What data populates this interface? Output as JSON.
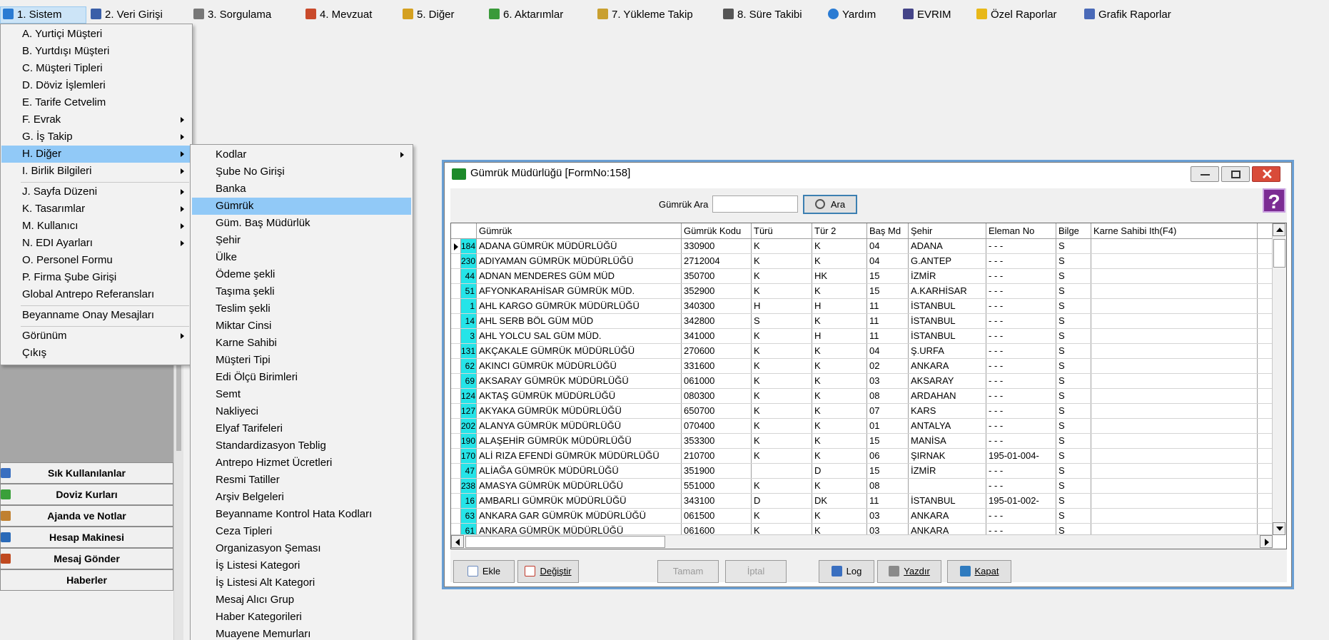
{
  "menubar": {
    "items": [
      {
        "label": "1.  Sistem",
        "icon": "system-icon",
        "color": "#2a7bd3"
      },
      {
        "label": "2.  Veri Girişi",
        "icon": "edit-icon",
        "color": "#3a5fa8"
      },
      {
        "label": "3.  Sorgulama",
        "icon": "query-icon",
        "color": "#777777"
      },
      {
        "label": "4.  Mevzuat",
        "icon": "books-icon",
        "color": "#c94a2b"
      },
      {
        "label": "5.  Diğer",
        "icon": "shapes-icon",
        "color": "#d4a020"
      },
      {
        "label": "6.  Aktarımlar",
        "icon": "transfer-icon",
        "color": "#3a9a3a"
      },
      {
        "label": "7.  Yükleme Takip",
        "icon": "truck-icon",
        "color": "#c9a030"
      },
      {
        "label": "8. Süre Takibi",
        "icon": "clock-icon",
        "color": "#555555"
      },
      {
        "label": "Yardım",
        "icon": "help-icon",
        "color": "#2a7bd3"
      },
      {
        "label": "EVRIM",
        "icon": "evrim-icon",
        "color": "#444488"
      },
      {
        "label": "Özel Raporlar",
        "icon": "star-icon",
        "color": "#e8b818"
      },
      {
        "label": "Grafik Raporlar",
        "icon": "chart-icon",
        "color": "#4a6ab8"
      }
    ]
  },
  "sistem_menu": {
    "items": [
      {
        "label": "A.  Yurtiçi Müşteri",
        "submenu": false
      },
      {
        "label": "B.  Yurtdışı Müşteri",
        "submenu": false
      },
      {
        "label": "C.  Müşteri Tipleri",
        "submenu": false
      },
      {
        "label": "D.  Döviz İşlemleri",
        "submenu": false
      },
      {
        "label": "E.  Tarife Cetvelim",
        "submenu": false
      },
      {
        "label": "F.  Evrak",
        "submenu": true
      },
      {
        "label": "G.  İş Takip",
        "submenu": true
      },
      {
        "label": "H.  Diğer",
        "submenu": true
      },
      {
        "label": "I.  Birlik Bilgileri",
        "submenu": true
      },
      {
        "label": "J.  Sayfa Düzeni",
        "submenu": true
      },
      {
        "label": "K.  Tasarımlar",
        "submenu": true
      },
      {
        "label": "M.  Kullanıcı",
        "submenu": true
      },
      {
        "label": "N.  EDI Ayarları",
        "submenu": true
      },
      {
        "label": "O.  Personel Formu",
        "submenu": false
      },
      {
        "label": "P.  Firma Şube Girişi",
        "submenu": false
      },
      {
        "label": "Global Antrepo Referansları",
        "submenu": false
      },
      {
        "label": "Beyanname Onay Mesajları",
        "submenu": false
      },
      {
        "label": "Görünüm",
        "submenu": true
      },
      {
        "label": "Çıkış",
        "submenu": false
      }
    ]
  },
  "diger_menu": {
    "items": [
      "Kodlar",
      "Şube No Girişi",
      "Banka",
      "Gümrük",
      "Güm. Baş Müdürlük",
      "Şehir",
      "Ülke",
      "Ödeme şekli",
      "Taşıma şekli",
      "Teslim şekli",
      "Miktar Cinsi",
      "Karne Sahibi",
      "Müşteri  Tipi",
      "Edi Ölçü Birimleri",
      "Semt",
      "Nakliyeci",
      "Elyaf Tarifeleri",
      "Standardizasyon Teblig",
      "Antrepo Hizmet Ücretleri",
      "Resmi Tatiller",
      "Arşiv Belgeleri",
      "Beyanname Kontrol Hata Kodları",
      "Ceza Tipleri",
      "Organizasyon Şeması",
      "İş Listesi Kategori",
      "İş Listesi Alt Kategori",
      "Mesaj Alıcı Grup",
      "Haber Kategorileri",
      "Muayene Memurları"
    ]
  },
  "left_panel": {
    "buttons": [
      {
        "label": "Sık Kullanılanlar",
        "icon": "favorites-icon",
        "color": "#3a6fc0"
      },
      {
        "label": "Doviz Kurları",
        "icon": "currency-icon",
        "color": "#3aa03a"
      },
      {
        "label": "Ajanda ve Notlar",
        "icon": "agenda-icon",
        "color": "#c08030"
      },
      {
        "label": "Hesap Makinesi",
        "icon": "calculator-icon",
        "color": "#2a6ab8"
      },
      {
        "label": "Mesaj Gönder",
        "icon": "users-icon",
        "color": "#c04a20"
      },
      {
        "label": "Haberler",
        "icon": "",
        "color": ""
      }
    ]
  },
  "window": {
    "title": "Gümrük Müdürlüğü [FormNo:158]",
    "search_label": "Gümrük Ara",
    "search_value": "",
    "search_button": "Ara",
    "columns": [
      "Gümrük",
      "Gümrük Kodu",
      "Türü",
      "Tür 2",
      "Baş Md",
      "Şehir",
      "Eleman No",
      "Bilge",
      "Karne Sahibi Ith(F4)"
    ],
    "rows": [
      [
        "184",
        "ADANA GÜMRÜK MÜDÜRLÜĞÜ",
        "330900",
        "K",
        "K",
        "04",
        "ADANA",
        " - - -",
        "S",
        ""
      ],
      [
        "230",
        "ADIYAMAN GÜMRÜK MÜDÜRLÜĞÜ",
        "2712004",
        "K",
        "K",
        "04",
        "G.ANTEP",
        " - - -",
        "S",
        ""
      ],
      [
        "44",
        "ADNAN MENDERES GÜM MÜD",
        "350700",
        "K",
        "HK",
        "15",
        "İZMİR",
        " - - -",
        "S",
        ""
      ],
      [
        "51",
        "AFYONKARAHİSAR GÜMRÜK MÜD.",
        "352900",
        "K",
        "K",
        "15",
        "A.KARHİSAR",
        " - - -",
        "S",
        ""
      ],
      [
        "1",
        "AHL KARGO GÜMRÜK MÜDÜRLÜĞÜ",
        "340300",
        "H",
        "H",
        "11",
        "İSTANBUL",
        " - - -",
        "S",
        ""
      ],
      [
        "14",
        "AHL SERB BÖL GÜM MÜD",
        "342800",
        "S",
        "K",
        "11",
        "İSTANBUL",
        " - - -",
        "S",
        ""
      ],
      [
        "3",
        "AHL YOLCU SAL GÜM MÜD.",
        "341000",
        "K",
        "H",
        "11",
        "İSTANBUL",
        " - - -",
        "S",
        ""
      ],
      [
        "131",
        "AKÇAKALE GÜMRÜK MÜDÜRLÜĞÜ",
        "270600",
        "K",
        "K",
        "04",
        "Ş.URFA",
        " - - -",
        "S",
        ""
      ],
      [
        "62",
        "AKINCI GÜMRÜK MÜDÜRLÜĞÜ",
        "331600",
        "K",
        "K",
        "02",
        "ANKARA",
        " - - -",
        "S",
        ""
      ],
      [
        "69",
        "AKSARAY GÜMRÜK MÜDÜRLÜĞÜ",
        "061000",
        "K",
        "K",
        "03",
        "AKSARAY",
        " - - -",
        "S",
        ""
      ],
      [
        "124",
        "AKTAŞ GÜMRÜK MÜDÜRLÜĞÜ",
        "080300",
        "K",
        "K",
        "08",
        "ARDAHAN",
        " - - -",
        "S",
        ""
      ],
      [
        "127",
        "AKYAKA GÜMRÜK MÜDÜRLÜĞÜ",
        "650700",
        "K",
        "K",
        "07",
        "KARS",
        " - - -",
        "S",
        ""
      ],
      [
        "202",
        "ALANYA GÜMRÜK MÜDÜRLÜĞÜ",
        "070400",
        "K",
        "K",
        "01",
        "ANTALYA",
        " - - -",
        "S",
        ""
      ],
      [
        "190",
        "ALAŞEHİR GÜMRÜK MÜDÜRLÜĞÜ",
        "353300",
        "K",
        "K",
        "15",
        "MANİSA",
        " - - -",
        "S",
        ""
      ],
      [
        "170",
        "ALİ RIZA EFENDİ GÜMRÜK MÜDÜRLÜĞÜ",
        "210700",
        "K",
        "K",
        "06",
        "ŞIRNAK",
        "195-01-004-",
        "S",
        ""
      ],
      [
        "47",
        "ALİAĞA GÜMRÜK MÜDÜRLÜĞÜ",
        "351900",
        "",
        "D",
        "15",
        "İZMİR",
        " - - -",
        "S",
        ""
      ],
      [
        "238",
        "AMASYA GÜMRÜK MÜDÜRLÜĞÜ",
        "551000",
        "K",
        "K",
        "08",
        "",
        " - - -",
        "S",
        ""
      ],
      [
        "16",
        "AMBARLI  GÜMRÜK MÜDÜRLÜĞÜ",
        "343100",
        "D",
        "DK",
        "11",
        "İSTANBUL",
        "195-01-002-",
        "S",
        ""
      ],
      [
        "63",
        "ANKARA GAR GÜMRÜK MÜDÜRLÜĞÜ",
        "061500",
        "K",
        "K",
        "03",
        "ANKARA",
        " - - -",
        "S",
        ""
      ],
      [
        "61",
        "ANKARA GÜMRÜK MÜDÜRLÜĞÜ",
        "061600",
        "K",
        "K",
        "03",
        "ANKARA",
        " - - -",
        "S",
        ""
      ]
    ],
    "buttons": {
      "ekle": "Ekle",
      "degistir": "Değiştir",
      "tamam": "Tamam",
      "iptal": "İptal",
      "log": "Log",
      "yazdir": "Yazdır",
      "kapat": "Kapat"
    },
    "help_glyph": "?"
  }
}
